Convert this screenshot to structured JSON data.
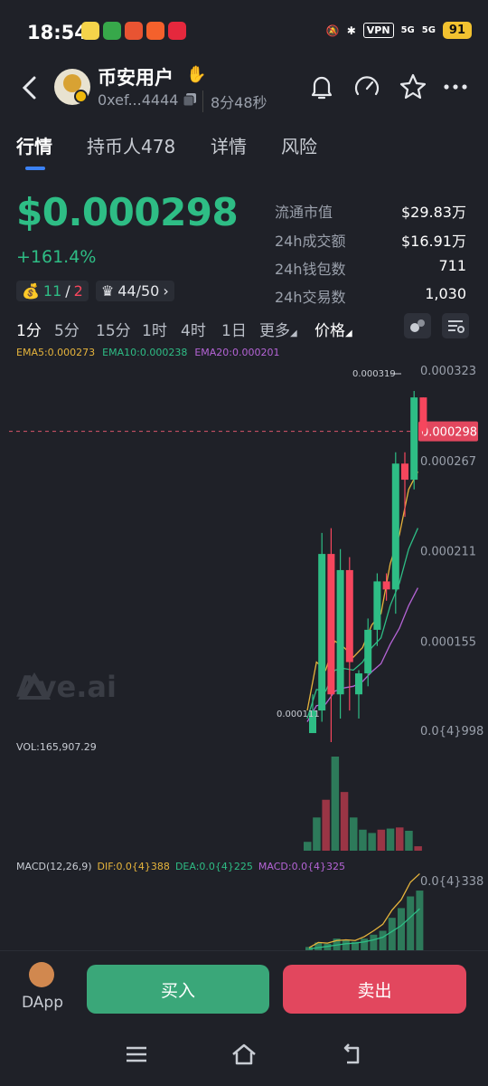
{
  "status_bar": {
    "time": "18:54",
    "vpn": "VPN",
    "signal1": "5G",
    "signal2": "5G",
    "battery": "91"
  },
  "header": {
    "token_name": "币安用户",
    "address": "0xef...4444",
    "age": "8分48秒"
  },
  "tabs": [
    {
      "label": "行情"
    },
    {
      "label": "持币人478"
    },
    {
      "label": "详情"
    },
    {
      "label": "风险"
    }
  ],
  "price": {
    "value": "$0.000298",
    "change": "+161.4%",
    "snipers_a": "11",
    "snipers_sep": "/",
    "snipers_b": "2",
    "holders_top": "44/50"
  },
  "market_stats": [
    {
      "label": "流通市值",
      "value": "$29.83万"
    },
    {
      "label": "24h成交额",
      "value": "$16.91万"
    },
    {
      "label": "24h钱包数",
      "value": "711"
    },
    {
      "label": "24h交易数",
      "value": "1,030"
    }
  ],
  "intervals": [
    "1分",
    "5分",
    "15分",
    "1时",
    "4时",
    "1日"
  ],
  "interval_more": "更多",
  "price_toggle": "价格",
  "ema": {
    "ema5": "EMA5:0.000273",
    "ema10": "EMA10:0.000238",
    "ema20": "EMA20:0.000201"
  },
  "watermark": "Ave.ai",
  "volume_label": "VOL:165,907.29",
  "macd": {
    "label": "MACD(12,26,9)",
    "dif": "DIF:0.0{4}388",
    "dea": "DEA:0.0{4}225",
    "macd": "MACD:0.0{4}325",
    "axis_top": "0.0{4}338"
  },
  "bottom": {
    "dapp": "DApp",
    "buy": "买入",
    "sell": "卖出"
  },
  "colors": {
    "up": "#2ebd85",
    "down": "#f6465d",
    "ema5": "#e6b43c",
    "ema10": "#2ebd85",
    "ema20": "#b564d6",
    "accent": "#3b82f6"
  },
  "chart_data": {
    "type": "candlestick",
    "price_axis_labels": [
      "0.000323",
      "0.000267",
      "0.000211",
      "0.000155",
      "0.0{4}998"
    ],
    "current_price_label": "0.000298",
    "high_label": "0.000319",
    "low_label": "0.000111",
    "candles": [
      {
        "o": 0.000111,
        "h": 0.000135,
        "l": 0.000111,
        "c": 0.000125
      },
      {
        "o": 0.000125,
        "h": 0.000235,
        "l": 0.000118,
        "c": 0.000222
      },
      {
        "o": 0.000222,
        "h": 0.000238,
        "l": 0.000105,
        "c": 0.000135
      },
      {
        "o": 0.000135,
        "h": 0.000225,
        "l": 0.00012,
        "c": 0.000212
      },
      {
        "o": 0.000212,
        "h": 0.00022,
        "l": 0.000125,
        "c": 0.000155
      },
      {
        "o": 0.000135,
        "h": 0.00015,
        "l": 0.00012,
        "c": 0.000148
      },
      {
        "o": 0.000148,
        "h": 0.000182,
        "l": 0.00014,
        "c": 0.000175
      },
      {
        "o": 0.000175,
        "h": 0.00021,
        "l": 0.000165,
        "c": 0.000205
      },
      {
        "o": 0.000205,
        "h": 0.00021,
        "l": 0.000193,
        "c": 0.0002
      },
      {
        "o": 0.0002,
        "h": 0.000285,
        "l": 0.000185,
        "c": 0.000278
      },
      {
        "o": 0.000278,
        "h": 0.000285,
        "l": 0.000245,
        "c": 0.000268
      },
      {
        "o": 0.000268,
        "h": 0.000323,
        "l": 0.000262,
        "c": 0.000319
      },
      {
        "o": 0.000319,
        "h": 0.000319,
        "l": 0.000295,
        "c": 0.000298
      }
    ],
    "ema5": [
      0.000125,
      0.000155,
      0.00015,
      0.000168,
      0.000164,
      0.000158,
      0.000164,
      0.000178,
      0.000185,
      0.000216,
      0.000234,
      0.000262,
      0.000273
    ],
    "ema10": [
      0.00012,
      0.000138,
      0.000137,
      0.00015,
      0.000151,
      0.00015,
      0.000155,
      0.000164,
      0.00017,
      0.00019,
      0.000204,
      0.000225,
      0.000238
    ],
    "ema20": [
      0.000118,
      0.000128,
      0.000129,
      0.000137,
      0.000139,
      0.00014,
      0.000143,
      0.000149,
      0.000154,
      0.000166,
      0.000176,
      0.00019,
      0.000201
    ],
    "volumes": [
      8,
      30,
      46,
      85,
      53,
      30,
      19,
      16,
      19,
      20,
      21,
      18,
      4
    ],
    "macd_hist": [
      0.5,
      1.2,
      1.0,
      1.8,
      1.6,
      1.3,
      1.8,
      2.4,
      3.0,
      5.0,
      6.5,
      8.3,
      9.2
    ],
    "macd_dif": [
      0.4,
      1.2,
      1.1,
      1.5,
      1.6,
      1.5,
      2.1,
      3.0,
      4.0,
      6.2,
      7.8,
      10.5,
      11.8
    ],
    "macd_dea": [
      0.2,
      0.4,
      0.6,
      0.8,
      1.0,
      1.1,
      1.3,
      1.6,
      2.0,
      2.9,
      3.8,
      5.1,
      6.4
    ]
  }
}
